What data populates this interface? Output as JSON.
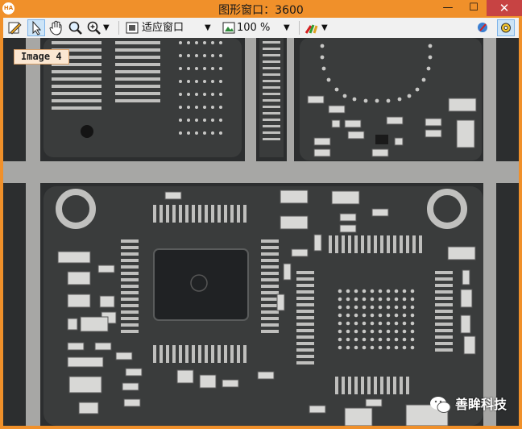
{
  "window": {
    "app_icon": "HA",
    "title": "图形窗口：3600",
    "minimize_glyph": "—",
    "maximize_glyph": "☐",
    "close_glyph": "✕"
  },
  "toolbar": {
    "fit_label": "适应窗口",
    "zoom_label": "100 %",
    "dropdown_glyph": "▼"
  },
  "viewport": {
    "image_label": "Image 4"
  },
  "watermark": {
    "text": "善眸科技"
  }
}
